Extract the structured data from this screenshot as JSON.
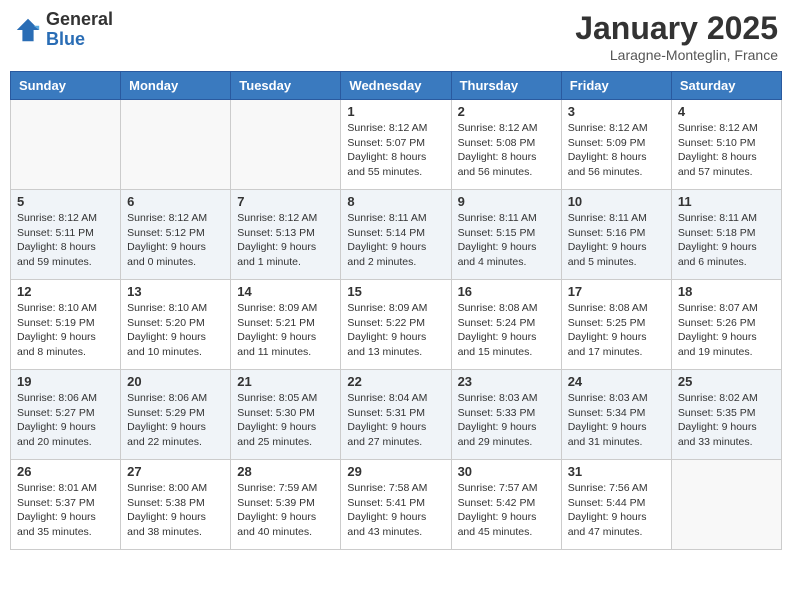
{
  "header": {
    "logo_general": "General",
    "logo_blue": "Blue",
    "month_title": "January 2025",
    "location": "Laragne-Monteglin, France"
  },
  "weekdays": [
    "Sunday",
    "Monday",
    "Tuesday",
    "Wednesday",
    "Thursday",
    "Friday",
    "Saturday"
  ],
  "weeks": [
    [
      {
        "day": "",
        "info": ""
      },
      {
        "day": "",
        "info": ""
      },
      {
        "day": "",
        "info": ""
      },
      {
        "day": "1",
        "info": "Sunrise: 8:12 AM\nSunset: 5:07 PM\nDaylight: 8 hours\nand 55 minutes."
      },
      {
        "day": "2",
        "info": "Sunrise: 8:12 AM\nSunset: 5:08 PM\nDaylight: 8 hours\nand 56 minutes."
      },
      {
        "day": "3",
        "info": "Sunrise: 8:12 AM\nSunset: 5:09 PM\nDaylight: 8 hours\nand 56 minutes."
      },
      {
        "day": "4",
        "info": "Sunrise: 8:12 AM\nSunset: 5:10 PM\nDaylight: 8 hours\nand 57 minutes."
      }
    ],
    [
      {
        "day": "5",
        "info": "Sunrise: 8:12 AM\nSunset: 5:11 PM\nDaylight: 8 hours\nand 59 minutes."
      },
      {
        "day": "6",
        "info": "Sunrise: 8:12 AM\nSunset: 5:12 PM\nDaylight: 9 hours\nand 0 minutes."
      },
      {
        "day": "7",
        "info": "Sunrise: 8:12 AM\nSunset: 5:13 PM\nDaylight: 9 hours\nand 1 minute."
      },
      {
        "day": "8",
        "info": "Sunrise: 8:11 AM\nSunset: 5:14 PM\nDaylight: 9 hours\nand 2 minutes."
      },
      {
        "day": "9",
        "info": "Sunrise: 8:11 AM\nSunset: 5:15 PM\nDaylight: 9 hours\nand 4 minutes."
      },
      {
        "day": "10",
        "info": "Sunrise: 8:11 AM\nSunset: 5:16 PM\nDaylight: 9 hours\nand 5 minutes."
      },
      {
        "day": "11",
        "info": "Sunrise: 8:11 AM\nSunset: 5:18 PM\nDaylight: 9 hours\nand 6 minutes."
      }
    ],
    [
      {
        "day": "12",
        "info": "Sunrise: 8:10 AM\nSunset: 5:19 PM\nDaylight: 9 hours\nand 8 minutes."
      },
      {
        "day": "13",
        "info": "Sunrise: 8:10 AM\nSunset: 5:20 PM\nDaylight: 9 hours\nand 10 minutes."
      },
      {
        "day": "14",
        "info": "Sunrise: 8:09 AM\nSunset: 5:21 PM\nDaylight: 9 hours\nand 11 minutes."
      },
      {
        "day": "15",
        "info": "Sunrise: 8:09 AM\nSunset: 5:22 PM\nDaylight: 9 hours\nand 13 minutes."
      },
      {
        "day": "16",
        "info": "Sunrise: 8:08 AM\nSunset: 5:24 PM\nDaylight: 9 hours\nand 15 minutes."
      },
      {
        "day": "17",
        "info": "Sunrise: 8:08 AM\nSunset: 5:25 PM\nDaylight: 9 hours\nand 17 minutes."
      },
      {
        "day": "18",
        "info": "Sunrise: 8:07 AM\nSunset: 5:26 PM\nDaylight: 9 hours\nand 19 minutes."
      }
    ],
    [
      {
        "day": "19",
        "info": "Sunrise: 8:06 AM\nSunset: 5:27 PM\nDaylight: 9 hours\nand 20 minutes."
      },
      {
        "day": "20",
        "info": "Sunrise: 8:06 AM\nSunset: 5:29 PM\nDaylight: 9 hours\nand 22 minutes."
      },
      {
        "day": "21",
        "info": "Sunrise: 8:05 AM\nSunset: 5:30 PM\nDaylight: 9 hours\nand 25 minutes."
      },
      {
        "day": "22",
        "info": "Sunrise: 8:04 AM\nSunset: 5:31 PM\nDaylight: 9 hours\nand 27 minutes."
      },
      {
        "day": "23",
        "info": "Sunrise: 8:03 AM\nSunset: 5:33 PM\nDaylight: 9 hours\nand 29 minutes."
      },
      {
        "day": "24",
        "info": "Sunrise: 8:03 AM\nSunset: 5:34 PM\nDaylight: 9 hours\nand 31 minutes."
      },
      {
        "day": "25",
        "info": "Sunrise: 8:02 AM\nSunset: 5:35 PM\nDaylight: 9 hours\nand 33 minutes."
      }
    ],
    [
      {
        "day": "26",
        "info": "Sunrise: 8:01 AM\nSunset: 5:37 PM\nDaylight: 9 hours\nand 35 minutes."
      },
      {
        "day": "27",
        "info": "Sunrise: 8:00 AM\nSunset: 5:38 PM\nDaylight: 9 hours\nand 38 minutes."
      },
      {
        "day": "28",
        "info": "Sunrise: 7:59 AM\nSunset: 5:39 PM\nDaylight: 9 hours\nand 40 minutes."
      },
      {
        "day": "29",
        "info": "Sunrise: 7:58 AM\nSunset: 5:41 PM\nDaylight: 9 hours\nand 43 minutes."
      },
      {
        "day": "30",
        "info": "Sunrise: 7:57 AM\nSunset: 5:42 PM\nDaylight: 9 hours\nand 45 minutes."
      },
      {
        "day": "31",
        "info": "Sunrise: 7:56 AM\nSunset: 5:44 PM\nDaylight: 9 hours\nand 47 minutes."
      },
      {
        "day": "",
        "info": ""
      }
    ]
  ]
}
